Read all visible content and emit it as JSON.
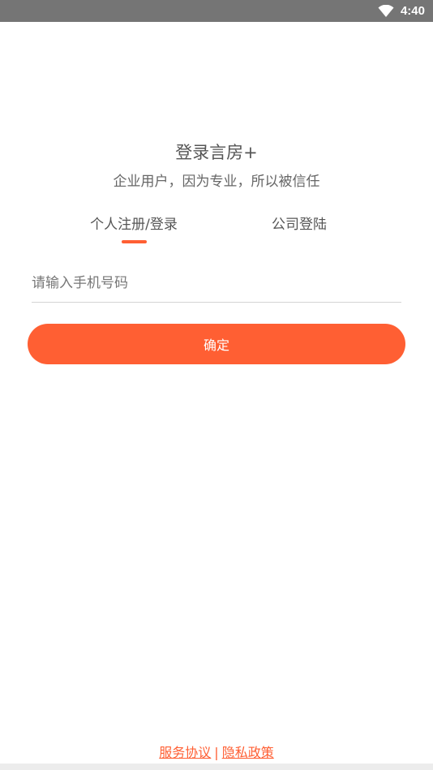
{
  "status_bar": {
    "time": "4:40",
    "icons": [
      "wifi-icon"
    ],
    "background": "#757575"
  },
  "header": {
    "title": "登录言房+",
    "subtitle": "企业用户，因为专业，所以被信任"
  },
  "tabs": [
    {
      "label": "个人注册/登录",
      "active": true
    },
    {
      "label": "公司登陆",
      "active": false
    }
  ],
  "form": {
    "phone_placeholder": "请输入手机号码",
    "phone_value": "",
    "confirm_label": "确定"
  },
  "footer": {
    "service_agreement": "服务协议",
    "separator": "|",
    "privacy_policy": "隐私政策"
  },
  "colors": {
    "accent": "#ff5f33",
    "text_primary": "#555555",
    "divider": "#d4d4d4"
  }
}
